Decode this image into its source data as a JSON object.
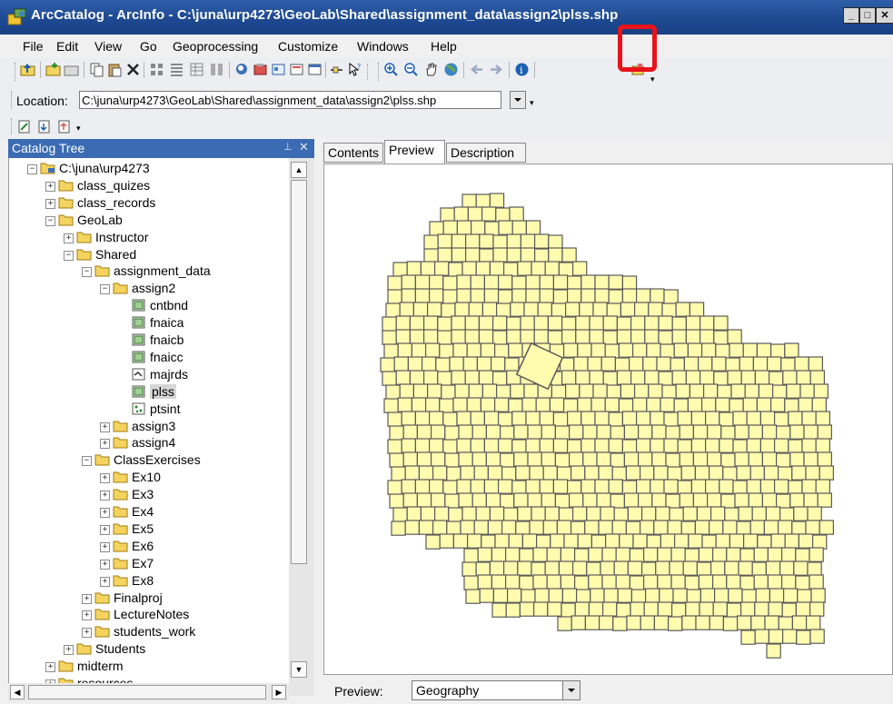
{
  "window": {
    "title": "ArcCatalog - ArcInfo - C:\\juna\\urp4273\\GeoLab\\Shared\\assignment_data\\assign2\\plss.shp",
    "min_label": "_",
    "max_label": "□"
  },
  "menu": [
    "File",
    "Edit",
    "View",
    "Go",
    "Geoprocessing",
    "Customize",
    "Windows",
    "Help"
  ],
  "location": {
    "label": "Location:",
    "value": "C:\\juna\\urp4273\\GeoLab\\Shared\\assignment_data\\assign2\\plss.shp"
  },
  "catalog_tree": {
    "title": "Catalog Tree",
    "items": [
      {
        "label": "C:\\juna\\urp4273",
        "exp": "⊟",
        "icon": "connection-icon"
      },
      {
        "label": "class_quizes",
        "exp": "⊞",
        "icon": "folder-icon"
      },
      {
        "label": "class_records",
        "exp": "⊞",
        "icon": "folder-icon"
      },
      {
        "label": "GeoLab",
        "exp": "⊟",
        "icon": "folder-icon"
      },
      {
        "label": "Instructor",
        "exp": "⊞",
        "icon": "folder-icon"
      },
      {
        "label": "Shared",
        "exp": "⊟",
        "icon": "folder-icon"
      },
      {
        "label": "assignment_data",
        "exp": "⊟",
        "icon": "folder-icon"
      },
      {
        "label": "assign2",
        "exp": "⊟",
        "icon": "folder-icon"
      },
      {
        "label": "cntbnd",
        "exp": "",
        "icon": "polygon-shapefile-icon"
      },
      {
        "label": "fnaica",
        "exp": "",
        "icon": "polygon-shapefile-icon"
      },
      {
        "label": "fnaicb",
        "exp": "",
        "icon": "polygon-shapefile-icon"
      },
      {
        "label": "fnaicc",
        "exp": "",
        "icon": "polygon-shapefile-icon"
      },
      {
        "label": "majrds",
        "exp": "",
        "icon": "line-shapefile-icon"
      },
      {
        "label": "plss",
        "exp": "",
        "icon": "polygon-shapefile-icon"
      },
      {
        "label": "ptsint",
        "exp": "",
        "icon": "point-shapefile-icon"
      },
      {
        "label": "assign3",
        "exp": "⊞",
        "icon": "folder-icon"
      },
      {
        "label": "assign4",
        "exp": "⊞",
        "icon": "folder-icon"
      },
      {
        "label": "ClassExercises",
        "exp": "⊟",
        "icon": "folder-icon"
      },
      {
        "label": "Ex10",
        "exp": "⊞",
        "icon": "folder-icon"
      },
      {
        "label": "Ex3",
        "exp": "⊞",
        "icon": "folder-icon"
      },
      {
        "label": "Ex4",
        "exp": "⊞",
        "icon": "folder-icon"
      },
      {
        "label": "Ex5",
        "exp": "⊞",
        "icon": "folder-icon"
      },
      {
        "label": "Ex6",
        "exp": "⊞",
        "icon": "folder-icon"
      },
      {
        "label": "Ex7",
        "exp": "⊞",
        "icon": "folder-icon"
      },
      {
        "label": "Ex8",
        "exp": "⊞",
        "icon": "folder-icon"
      },
      {
        "label": "Finalproj",
        "exp": "⊞",
        "icon": "folder-icon"
      },
      {
        "label": "LectureNotes",
        "exp": "⊞",
        "icon": "folder-icon"
      },
      {
        "label": "students_work",
        "exp": "⊞",
        "icon": "folder-icon"
      },
      {
        "label": "Students",
        "exp": "⊞",
        "icon": "folder-icon"
      },
      {
        "label": "midterm",
        "exp": "⊞",
        "icon": "folder-icon"
      },
      {
        "label": "resources",
        "exp": "⊞",
        "icon": "folder-icon"
      }
    ],
    "selected": "plss"
  },
  "tabs": [
    "Contents",
    "Preview",
    "Description"
  ],
  "active_tab": "Preview",
  "preview": {
    "label": "Preview:",
    "mode": "Geography",
    "fill_color": "#fffcb0",
    "stroke_color": "#5a5a5a"
  },
  "highlight_color": "#e8131b"
}
